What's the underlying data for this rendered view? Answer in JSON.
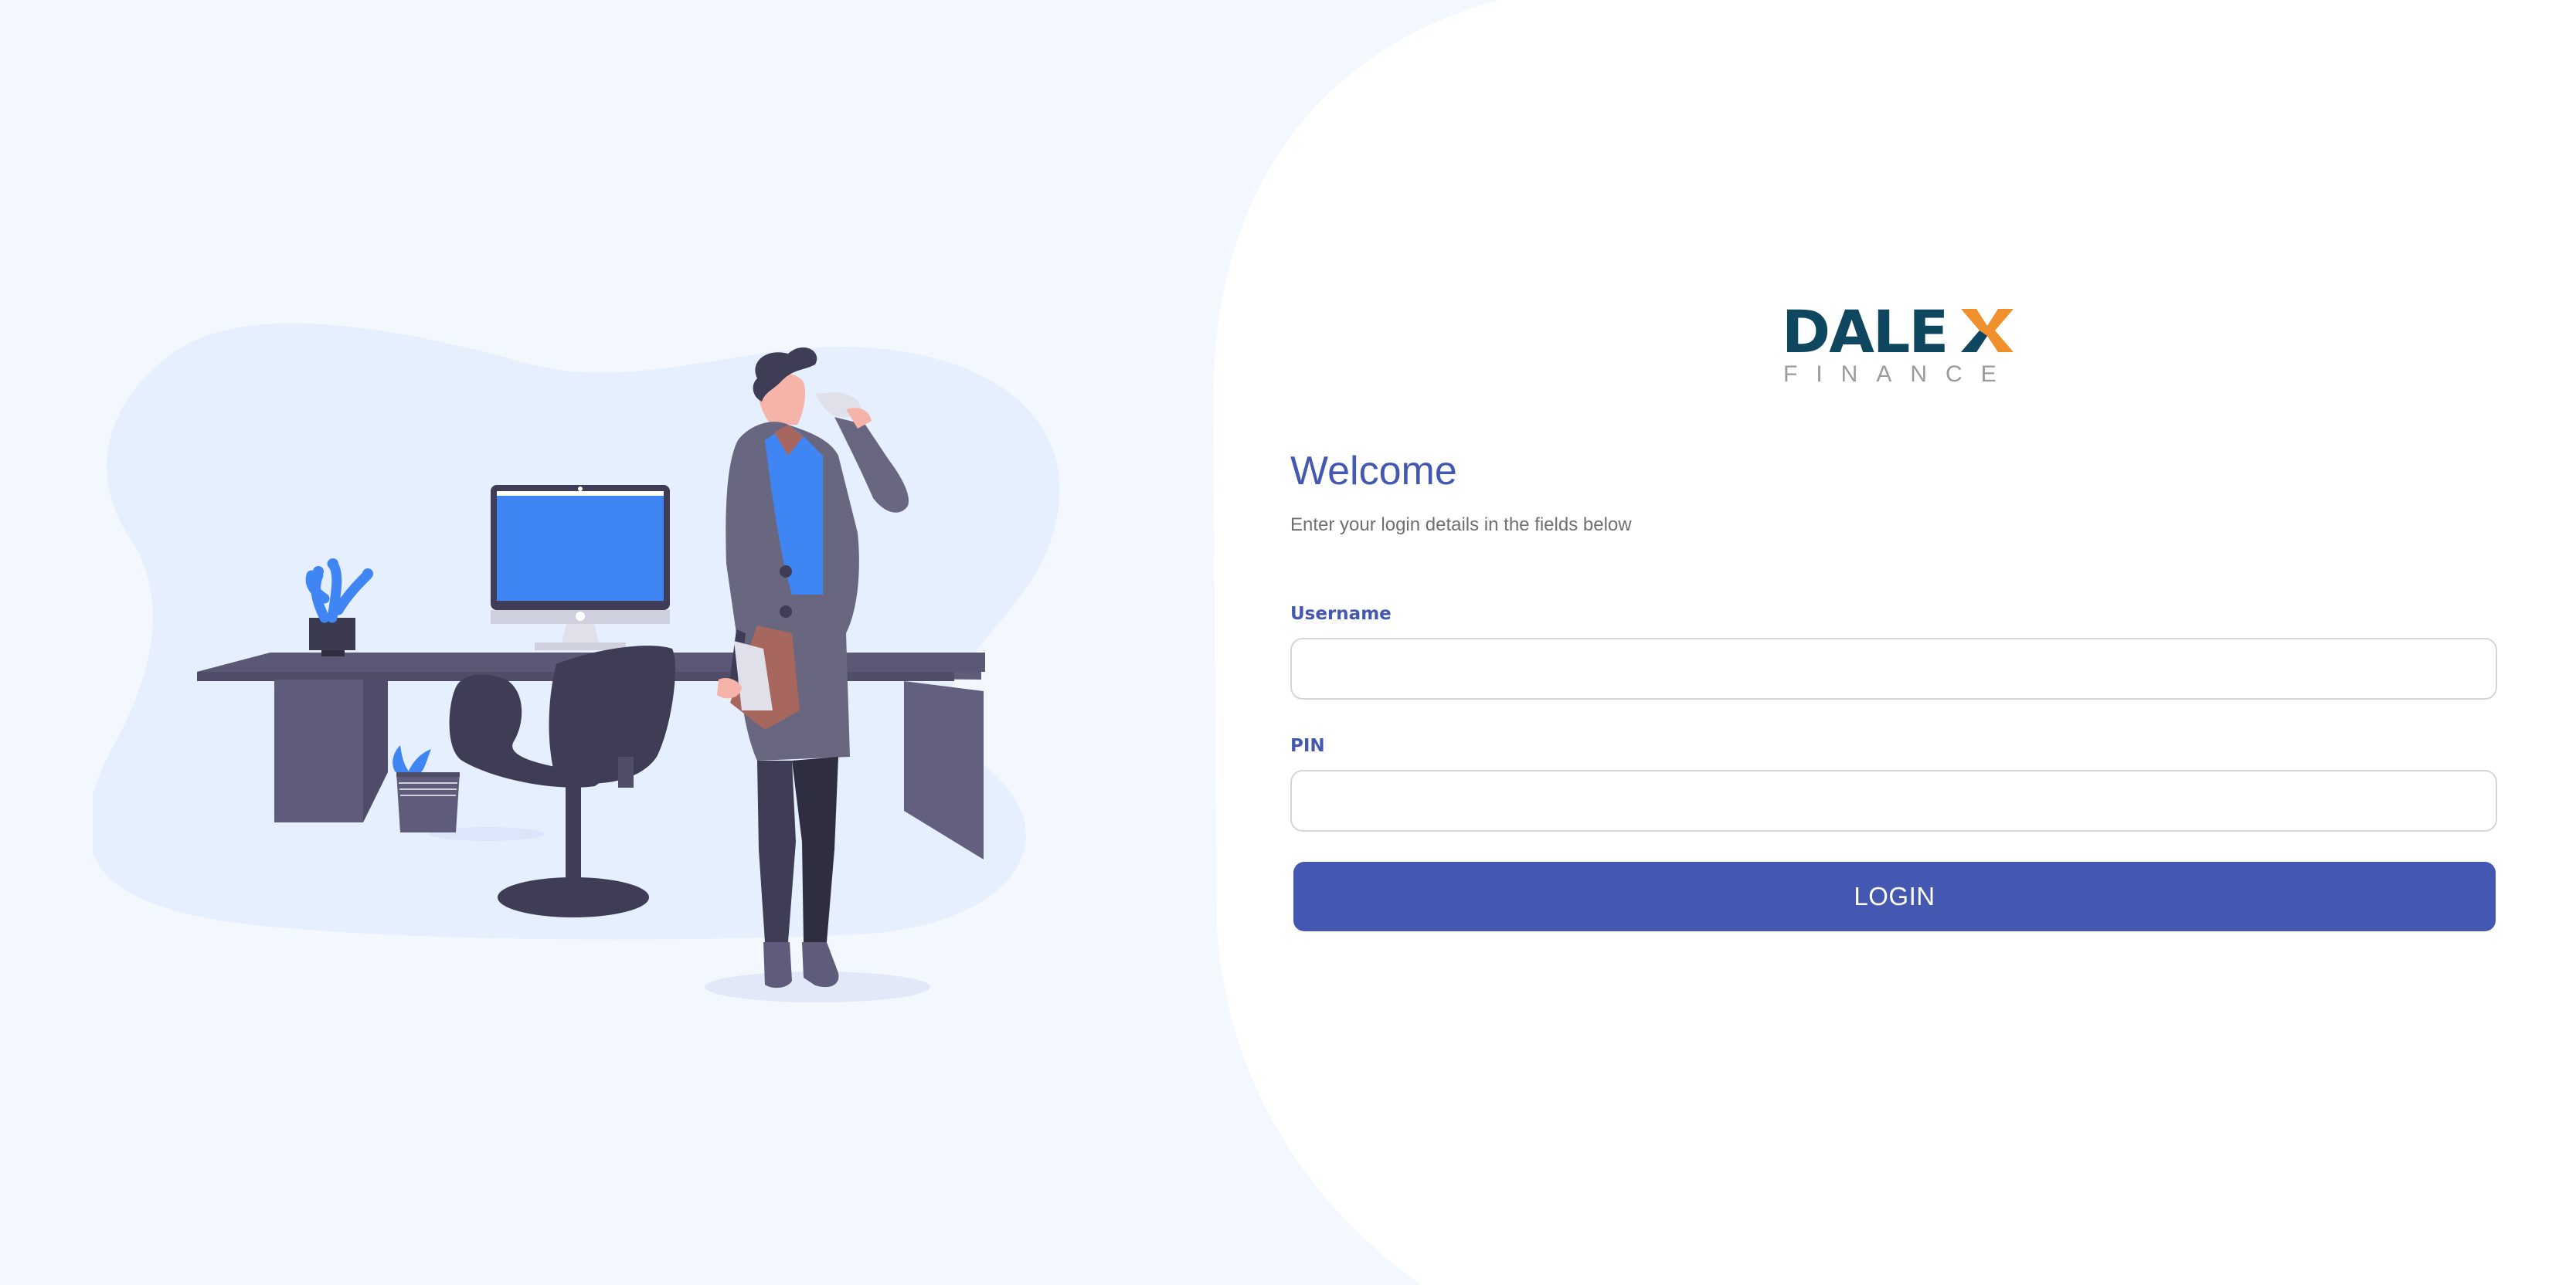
{
  "logo": {
    "brand": "DALEX",
    "tagline": "FINANCE",
    "color_primary": "#0f4660",
    "color_accent": "#f0902c",
    "color_tagline": "#9a9a9a"
  },
  "illustration": {
    "description_icon": "office-man-coffee-illustration"
  },
  "login": {
    "title": "Welcome",
    "subtitle": "Enter your login details in the fields below",
    "username_label": "Username",
    "username_value": "",
    "username_placeholder": "",
    "pin_label": "PIN",
    "pin_value": "",
    "pin_placeholder": "",
    "button_label": "LOGIN"
  },
  "colors": {
    "accent": "#4458b1",
    "background": "#f3f7fe",
    "panel": "#ffffff",
    "illustration_blob": "#e6effd"
  }
}
